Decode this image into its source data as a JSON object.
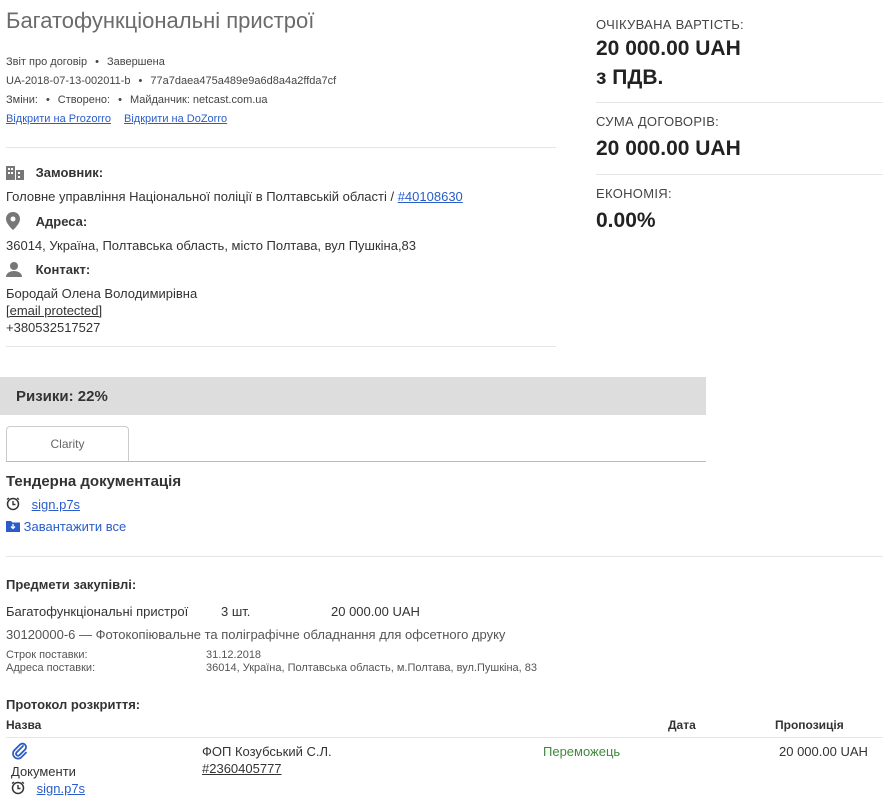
{
  "header": {
    "title": "Багатофункціональні пристрої",
    "report_type": "Звіт про договір",
    "status": "Завершена",
    "tender_id": "UA-2018-07-13-002011-b",
    "hash": "77a7daea475a489e9a6d8a4a2ffda7cf",
    "changes_label": "Зміни:",
    "created_label": "Створено:",
    "platform_label": "Майданчик: netcast.com.ua",
    "link_prozorro": "Відкрити на Prozorro",
    "link_dozorro": "Відкрити на DoZorro"
  },
  "customer": {
    "label": "Замовник:",
    "name": "Головне управління Національної поліції в Полтавській області /",
    "code": "#40108630",
    "address_label": "Адреса:",
    "address": "36014, Україна, Полтавська область, місто Полтава, вул Пушкіна,83",
    "contact_label": "Контакт:",
    "contact_name": "Бородай Олена Володимирівна",
    "contact_email": "[email protected]",
    "contact_phone": "+380532517527"
  },
  "summary": {
    "expected_label": "ОЧІКУВАНА ВАРТІСТЬ:",
    "expected_value_line1": "20 000.00 UAH",
    "expected_value_line2": "з ПДВ.",
    "contracts_label": "СУМА ДОГОВОРІВ:",
    "contracts_value": "20 000.00 UAH",
    "economy_label": "ЕКОНОМІЯ:",
    "economy_value": "0.00%"
  },
  "risk": {
    "label": "Ризики: 22%"
  },
  "tabs": [
    {
      "label": "Clarity"
    }
  ],
  "docs": {
    "heading": "Тендерна документація",
    "file": "sign.p7s",
    "download_all": "Завантажити все"
  },
  "items": {
    "heading": "Предмети закупівлі:",
    "name": "Багатофункціональні пристрої",
    "qty": "3 шт.",
    "price": "20 000.00 UAH",
    "cpv": "30120000-6 — Фотокопіювальне та поліграфічне обладнання для офсетного друку",
    "delivery_term_label": "Строк поставки:",
    "delivery_term": "31.12.2018",
    "delivery_address_label": "Адреса поставки:",
    "delivery_address": "36014, Україна, Полтавська область, м.Полтава, вул.Пушкіна, 83"
  },
  "protocol": {
    "heading": "Протокол розкриття:",
    "col_name": "Назва",
    "col_date": "Дата",
    "col_offer": "Пропозиція",
    "row": {
      "docs_label": "Документи",
      "file": "sign.p7s",
      "supplier": "ФОП Козубський С.Л.",
      "supplier_code": "#2360405777",
      "status": "Переможець",
      "offer": "20 000.00 UAH"
    }
  },
  "colors": {
    "link": "#2a5dc9",
    "winner": "#3c8a3c",
    "risk_bg": "#dddddd"
  }
}
